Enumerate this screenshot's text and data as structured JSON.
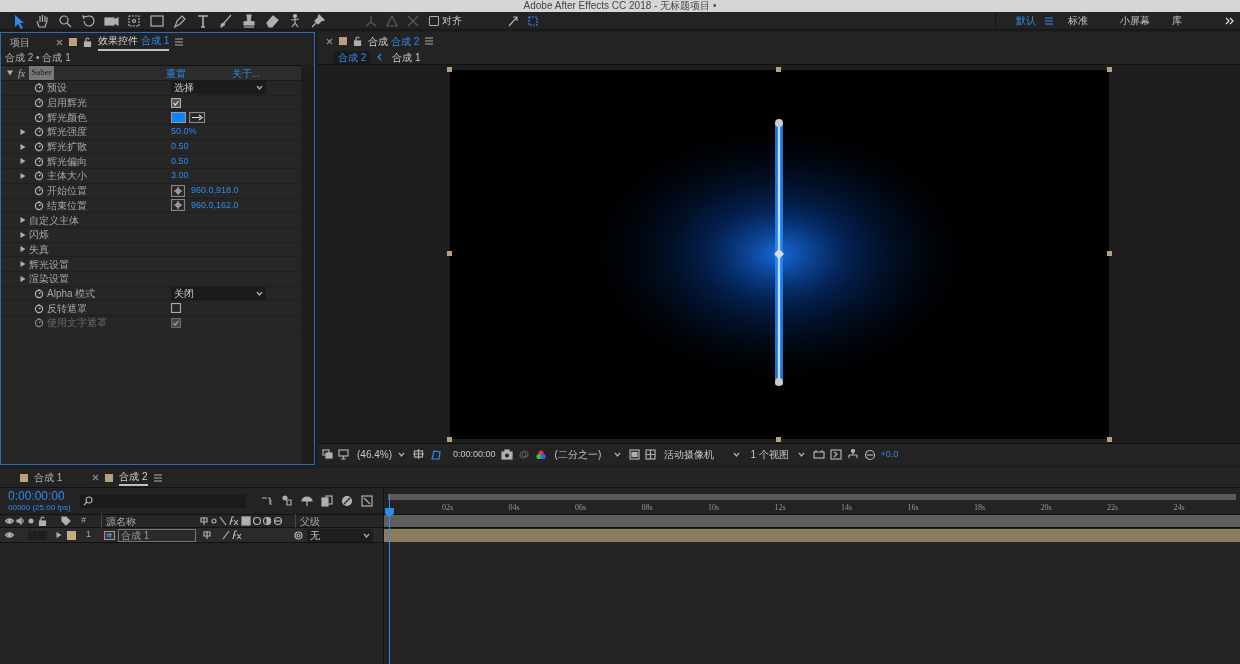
{
  "window": {
    "title": "Adobe After Effects CC 2018 - 无标题项目 •"
  },
  "toolbar": {
    "snap": {
      "label": "对齐",
      "checked": false
    }
  },
  "workspaces": [
    {
      "label": "默认",
      "selected": true
    },
    {
      "label": "标准",
      "selected": false
    },
    {
      "label": "小屏幕",
      "selected": false
    },
    {
      "label": "库",
      "selected": false
    }
  ],
  "effect_panel": {
    "tabs": [
      {
        "label": "项目",
        "selected": false
      },
      {
        "label": "效果控件",
        "comp": "合成 1",
        "selected": true
      }
    ],
    "breadcrumb": "合成 2 • 合成 1",
    "effect": {
      "fx": "fx",
      "name": "Saber",
      "reset": "重置",
      "about": "关于...",
      "expanded": true
    },
    "properties": [
      {
        "kind": "dropdown",
        "label": "预设",
        "value": "选择"
      },
      {
        "kind": "checkbox",
        "label": "启用辉光",
        "checked": true,
        "disabled": false
      },
      {
        "kind": "color",
        "label": "辉光颜色",
        "color": "#0a84ff"
      },
      {
        "kind": "number",
        "label": "辉光强度",
        "value": "50.0%",
        "expanded": false
      },
      {
        "kind": "number",
        "label": "辉光扩散",
        "value": "0.50",
        "expanded": false
      },
      {
        "kind": "number",
        "label": "辉光偏向",
        "value": "0.50",
        "expanded": false
      },
      {
        "kind": "number",
        "label": "主体大小",
        "value": "3.00",
        "expanded": false
      },
      {
        "kind": "point",
        "label": "开始位置",
        "value": "960.0,918.0"
      },
      {
        "kind": "point",
        "label": "结束位置",
        "value": "960.0,162.0"
      },
      {
        "kind": "group",
        "label": "自定义主体",
        "expanded": false
      },
      {
        "kind": "group",
        "label": "闪烁",
        "expanded": false
      },
      {
        "kind": "group",
        "label": "失真",
        "expanded": false
      },
      {
        "kind": "group",
        "label": "辉光设置",
        "expanded": false
      },
      {
        "kind": "group",
        "label": "渲染设置",
        "expanded": false
      },
      {
        "kind": "dropdown",
        "label": "Alpha 模式",
        "value": "关闭"
      },
      {
        "kind": "checkbox",
        "label": "反转遮罩",
        "checked": false,
        "disabled": false
      },
      {
        "kind": "checkbox",
        "label": "使用文字遮罩",
        "checked": true,
        "disabled": true
      }
    ]
  },
  "viewer": {
    "tab": {
      "label": "合成",
      "comp": "合成 2"
    },
    "crumbs": [
      {
        "label": "合成 2",
        "selected": true
      },
      {
        "label": "合成 1",
        "selected": false
      }
    ],
    "zoom": "(46.4%)",
    "time": "0:00:00:00",
    "resolution": "(二分之一)",
    "camera": "活动摄像机",
    "views": "1 个视图",
    "exposure": "+0.0"
  },
  "timeline": {
    "tabs": [
      {
        "label": "合成 1",
        "selected": false
      },
      {
        "label": "合成 2",
        "selected": true
      }
    ],
    "timecode": "0:00:00:00",
    "fps": "00000 (25.00 fps)",
    "columns": {
      "number": "#",
      "source": "源名称",
      "parent": "父级"
    },
    "layers": [
      {
        "number": "1",
        "name": "合成 1",
        "parent": "无",
        "visible": true
      }
    ],
    "ruler": [
      "02s",
      "04s",
      "06s",
      "08s",
      "10s",
      "12s",
      "14s",
      "16s",
      "18s",
      "20s",
      "22s",
      "24s"
    ]
  }
}
